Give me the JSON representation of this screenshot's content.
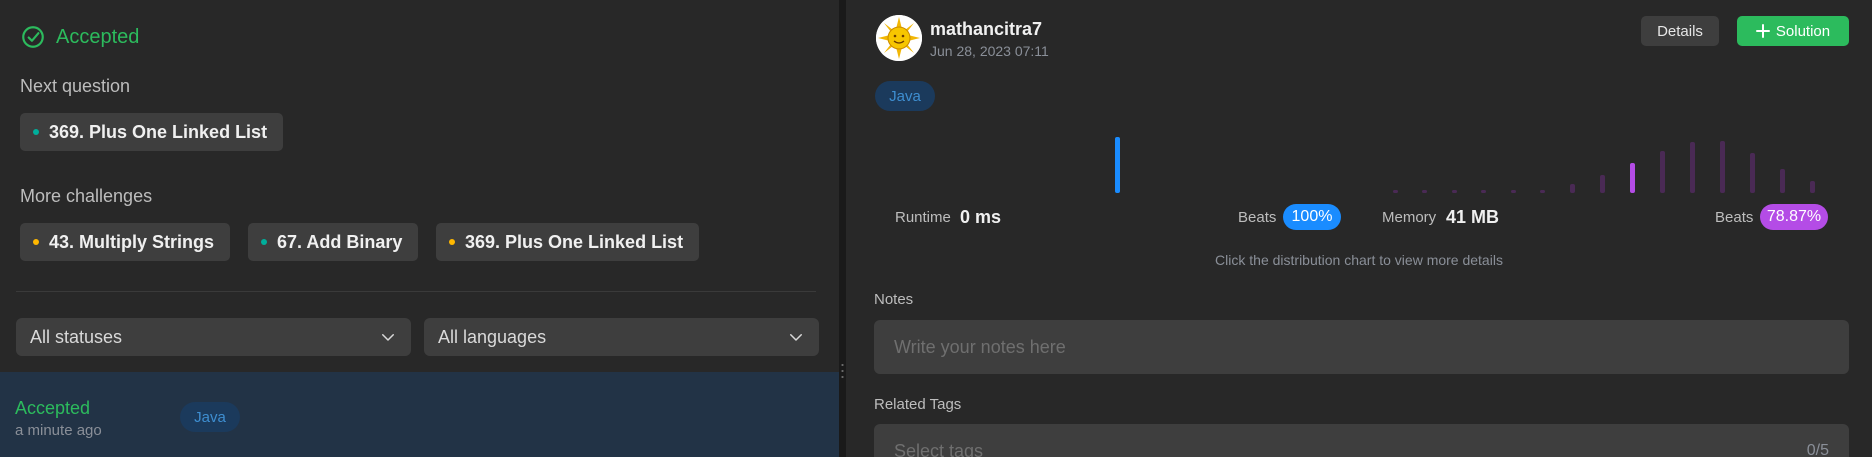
{
  "left_panel": {
    "result_status": "Accepted",
    "next_question_label": "Next question",
    "next_question": {
      "label": "369. Plus One Linked List",
      "dot_color": "#00af9b"
    },
    "more_challenges_label": "More challenges",
    "challenges": [
      {
        "label": "43. Multiply Strings",
        "dot_color": "#ffb800"
      },
      {
        "label": "67. Add Binary",
        "dot_color": "#00af9b"
      },
      {
        "label": "369. Plus One Linked List",
        "dot_color": "#ffb800"
      }
    ],
    "status_filter": "All statuses",
    "language_filter": "All languages",
    "submission": {
      "status": "Accepted",
      "time": "a minute ago",
      "language": "Java"
    }
  },
  "right_panel": {
    "user": {
      "name": "mathancitra7",
      "date": "Jun 28, 2023 07:11"
    },
    "details_button": "Details",
    "solution_button": "Solution",
    "language": "Java",
    "runtime": {
      "label": "Runtime",
      "value": "0 ms",
      "beats_label": "Beats",
      "beats_value": "100%",
      "badge_color": "#1a8cff"
    },
    "memory": {
      "label": "Memory",
      "value": "41 MB",
      "beats_label": "Beats",
      "beats_value": "78.87%",
      "badge_color": "#b44ce6"
    },
    "chart_hint": "Click the distribution chart to view more details",
    "notes_label": "Notes",
    "notes_placeholder": "Write your notes here",
    "related_tags_label": "Related Tags",
    "tags_placeholder": "Select tags",
    "tags_count": "0/5"
  },
  "colors": {
    "accepted_green": "#2cbb5d",
    "runtime_bar": "#1a8cff",
    "memory_highlight_bar": "#b44ce6",
    "memory_bar": "#4a2a55"
  }
}
